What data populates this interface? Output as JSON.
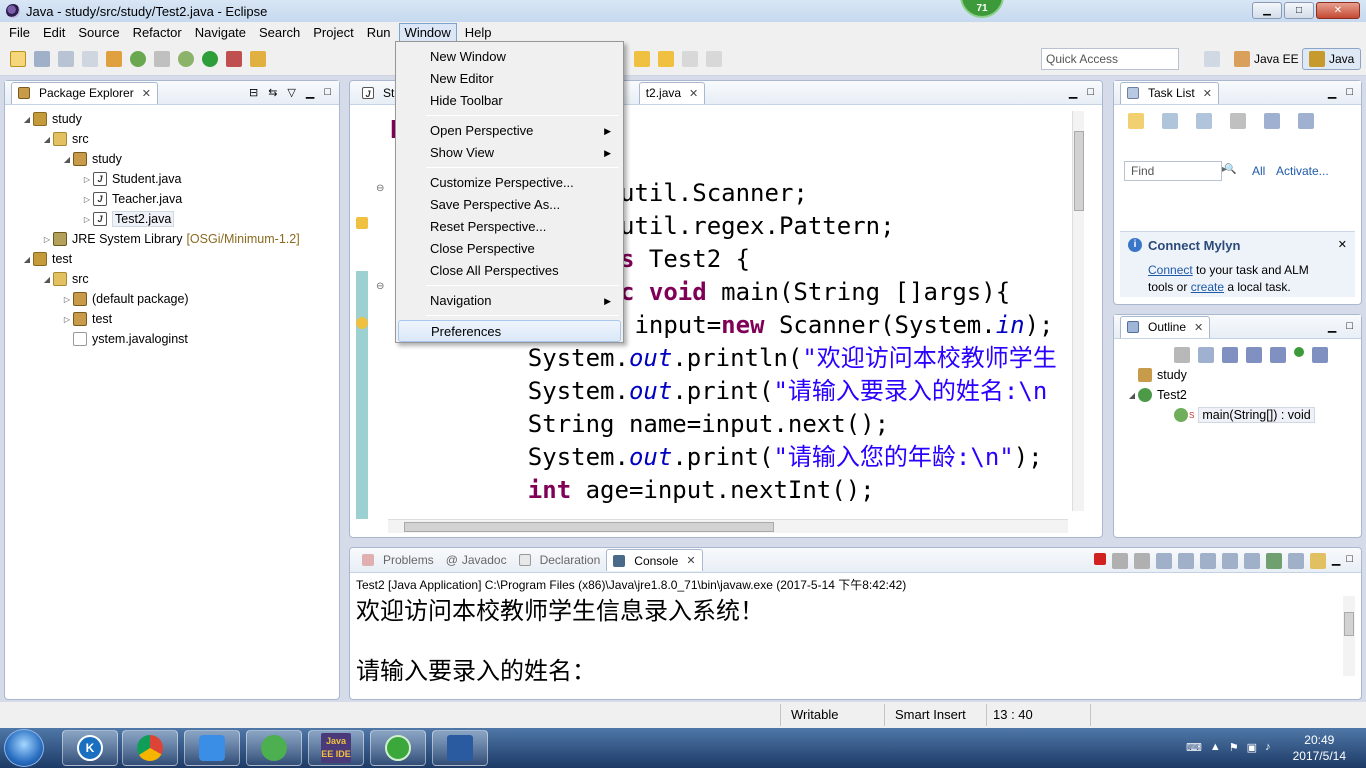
{
  "window": {
    "title": "Java - study/src/study/Test2.java - Eclipse",
    "badge": "71",
    "min": "▁",
    "max": "□",
    "close": "✕"
  },
  "menubar": [
    "File",
    "Edit",
    "Source",
    "Refactor",
    "Navigate",
    "Search",
    "Project",
    "Run",
    "Window",
    "Help"
  ],
  "toolbar": {
    "quick_access_placeholder": "Quick Access",
    "perspectives": [
      "Java EE",
      "Java"
    ]
  },
  "package_explorer": {
    "title": "Package Explorer",
    "rows": [
      {
        "label": "study",
        "icon": "project-icon",
        "arrow": "◢",
        "indent": 0
      },
      {
        "label": "src",
        "icon": "source-folder-icon",
        "arrow": "◢",
        "indent": 1
      },
      {
        "label": "study",
        "icon": "package-icon",
        "arrow": "◢",
        "indent": 2
      },
      {
        "label": "Student.java",
        "icon": "java-file-icon",
        "arrow": "▷",
        "indent": 3
      },
      {
        "label": "Teacher.java",
        "icon": "java-file-icon",
        "arrow": "▷",
        "indent": 3
      },
      {
        "label": "Test2.java",
        "icon": "java-file-icon",
        "arrow": "▷",
        "indent": 3,
        "selected": true
      },
      {
        "label": "JRE System Library",
        "suffix": "[OSGi/Minimum-1.2]",
        "icon": "library-icon",
        "arrow": "▷",
        "indent": 1
      },
      {
        "label": "test",
        "icon": "project-icon",
        "arrow": "◢",
        "indent": 0
      },
      {
        "label": "src",
        "icon": "source-folder-icon",
        "arrow": "◢",
        "indent": 1
      },
      {
        "label": "(default package)",
        "icon": "package-icon",
        "arrow": "▷",
        "indent": 2
      },
      {
        "label": "test",
        "icon": "package-icon",
        "arrow": "▷",
        "indent": 2
      },
      {
        "label": "ystem.javaloginst",
        "icon": "file-icon",
        "arrow": "",
        "indent": 2
      }
    ]
  },
  "editor": {
    "tabs": [
      "Stud",
      "t2.java"
    ],
    "lines": [
      {
        "pre": "",
        "kw": "p",
        "rest": ""
      },
      {
        "pre": "",
        "kw": "",
        "rest": "util.Scanner;"
      },
      {
        "pre": "",
        "kw": "",
        "rest": "util.regex.Pattern;"
      },
      {
        "pre": "",
        "kw": "s",
        "rest": " Test2 {"
      },
      {
        "pre": "",
        "kw": "c void",
        "rest": " main(String []args){"
      },
      {
        "pre": "",
        "kw": "",
        "rest": " input=",
        "kw2": "new",
        "rest2": " Scanner(System.",
        "fld": "in",
        "rest3": ");"
      },
      {
        "pre": "    System.",
        "fld": "out",
        "rest": ".println(",
        "str": "\"欢迎访问本校教师学生"
      },
      {
        "pre": "    System.",
        "fld": "out",
        "rest": ".print(",
        "str": "\"请输入要录入的姓名:\\n"
      },
      {
        "pre": "    String name=input.next();"
      },
      {
        "pre": "    System.",
        "fld": "out",
        "rest": ".print(",
        "str": "\"请输入您的年龄:\\n\"",
        "rest3": ");"
      },
      {
        "pre": "    ",
        "kw": "int",
        "rest": " age=input.nextInt();"
      }
    ]
  },
  "window_menu": {
    "items": [
      {
        "label": "New Window"
      },
      {
        "label": "New Editor"
      },
      {
        "label": "Hide Toolbar"
      },
      {
        "sep": true
      },
      {
        "label": "Open Perspective",
        "sub": true
      },
      {
        "label": "Show View",
        "sub": true
      },
      {
        "sep": true
      },
      {
        "label": "Customize Perspective..."
      },
      {
        "label": "Save Perspective As..."
      },
      {
        "label": "Reset Perspective..."
      },
      {
        "label": "Close Perspective"
      },
      {
        "label": "Close All Perspectives"
      },
      {
        "sep": true
      },
      {
        "label": "Navigation",
        "sub": true
      },
      {
        "sep": true
      },
      {
        "label": "Preferences",
        "highlighted": true
      }
    ]
  },
  "task_list": {
    "title": "Task List",
    "find_placeholder": "Find",
    "all": "All",
    "activate": "Activate...",
    "scope_arrow": "▸"
  },
  "mylyn": {
    "title": "Connect Mylyn",
    "connect": "Connect",
    "text1": " to your task and ALM",
    "text2": "tools or ",
    "create": "create",
    "text3": " a local task.",
    "info": "i"
  },
  "outline": {
    "title": "Outline",
    "items": [
      {
        "label": "study",
        "indent": 0
      },
      {
        "label": "Test2",
        "indent": 0,
        "arrow": "◢"
      },
      {
        "label": "main(String[]) : void",
        "indent": 1,
        "selected": true,
        "mark": "S"
      }
    ]
  },
  "console": {
    "tabs": [
      "Problems",
      "Javadoc",
      "Declaration",
      "Console"
    ],
    "info": "Test2 [Java Application] C:\\Program Files (x86)\\Java\\jre1.8.0_71\\bin\\javaw.exe (2017-5-14 下午8:42:42)",
    "lines": [
      "欢迎访问本校教师学生信息录入系统！",
      "",
      "请输入要录入的姓名："
    ]
  },
  "status": {
    "writable": "Writable",
    "insert": "Smart Insert",
    "position": "13 : 40"
  },
  "taskbar": {
    "time": "20:49",
    "date": "2017/5/14",
    "java_ee_label": "Java EE IDE"
  },
  "colors": {
    "keyword": "#7f0055",
    "string": "#2a00ff",
    "field": "#0000c0",
    "menu_highlight": "#dbe8f8"
  }
}
